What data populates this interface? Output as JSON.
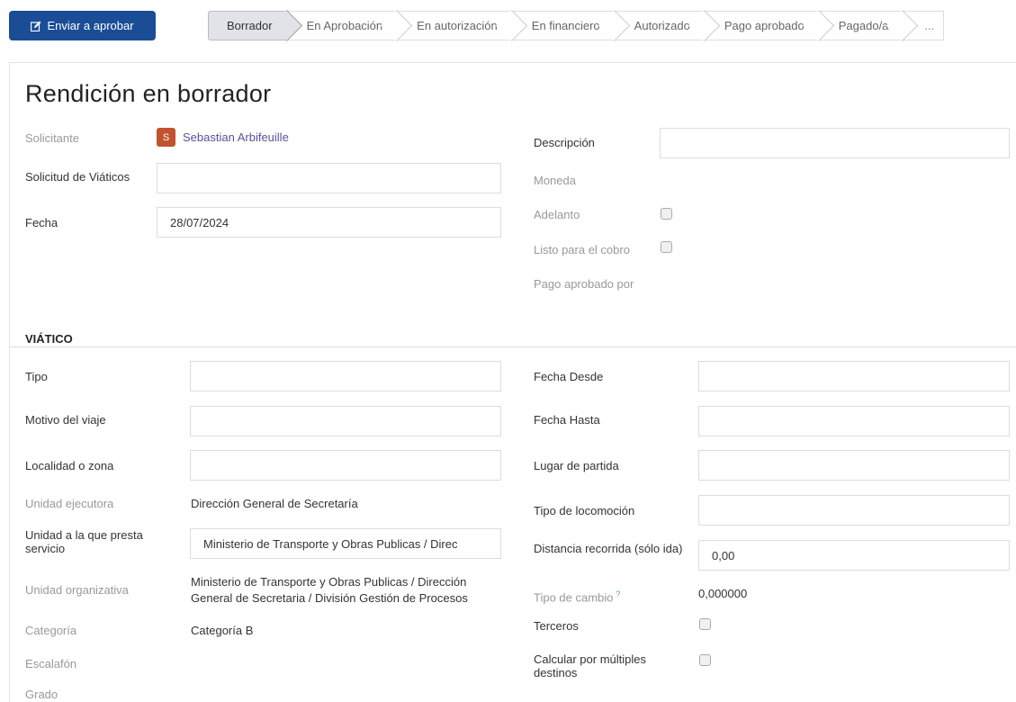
{
  "toolbar": {
    "submit_label": "Enviar a aprobar"
  },
  "statusbar": {
    "stages": [
      "Borrador",
      "En Aprobación",
      "En autorización",
      "En financiero",
      "Autorizado",
      "Pago aprobado",
      "Pagado/a"
    ],
    "active_index": 0,
    "more_label": "..."
  },
  "form": {
    "title": "Rendición en borrador",
    "solicitante_label": "Solicitante",
    "solicitante_initial": "S",
    "solicitante_name": "Sebastian Arbifeuille",
    "solicitud_label": "Solicitud de Viáticos",
    "solicitud_value": "",
    "fecha_label": "Fecha",
    "fecha_value": "28/07/2024",
    "descripcion_label": "Descripción",
    "descripcion_value": "",
    "moneda_label": "Moneda",
    "adelanto_label": "Adelanto",
    "listo_label": "Listo para el cobro",
    "pago_aprobado_label": "Pago aprobado por"
  },
  "viatico": {
    "section_title": "VIÁTICO",
    "tipo_label": "Tipo",
    "motivo_label": "Motivo del viaje",
    "localidad_label": "Localidad o zona",
    "unidad_ejecutora_label": "Unidad ejecutora",
    "unidad_ejecutora_value": "Dirección General de Secretaría",
    "unidad_presta_label": "Unidad a la que presta servicio",
    "unidad_presta_value": "Ministerio de Transporte y Obras Publicas / Direc",
    "unidad_org_label": "Unidad organizativa",
    "unidad_org_value": "Ministerio de Transporte y Obras Publicas / Dirección General de Secretaria / División Gestión de Procesos",
    "categoria_label": "Categoría",
    "categoria_value": "Categoría B",
    "escalafon_label": "Escalafón",
    "grado_label": "Grado",
    "fecha_desde_label": "Fecha Desde",
    "fecha_hasta_label": "Fecha Hasta",
    "lugar_partida_label": "Lugar de partida",
    "tipo_locomocion_label": "Tipo de locomoción",
    "distancia_label": "Distancia recorrida (sólo ida)",
    "distancia_value": "0,00",
    "tipo_cambio_label": "Tipo de cambio",
    "tipo_cambio_help": "?",
    "tipo_cambio_value": "0,000000",
    "terceros_label": "Terceros",
    "multiples_label": "Calcular por múltiples destinos"
  }
}
